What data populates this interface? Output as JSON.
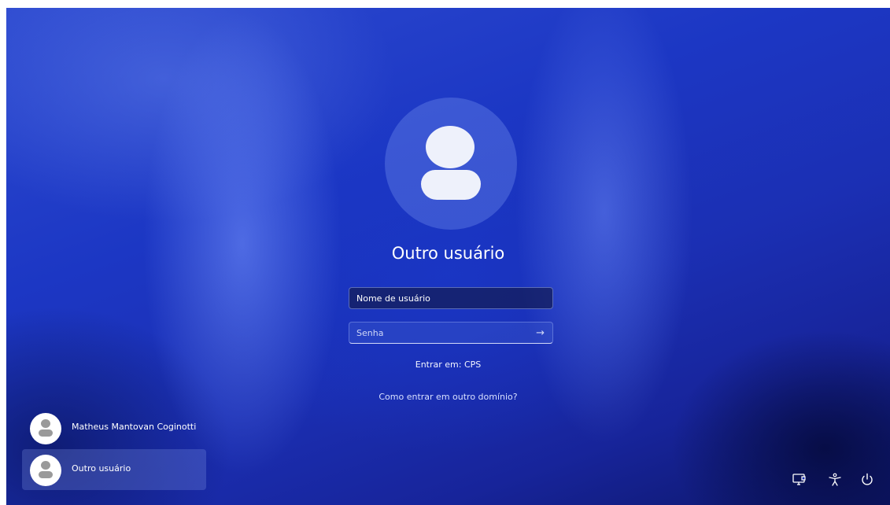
{
  "login": {
    "title": "Outro usuário",
    "username_placeholder": "Nome de usuário",
    "password_placeholder": "Senha",
    "signin_to": "Entrar em: CPS",
    "other_domain_link": "Como entrar em outro domínio?"
  },
  "users": [
    {
      "name": "Matheus Mantovan Coginotti"
    },
    {
      "name": "Outro usuário"
    }
  ],
  "system_icons": [
    "network-icon",
    "accessibility-icon",
    "power-icon"
  ]
}
